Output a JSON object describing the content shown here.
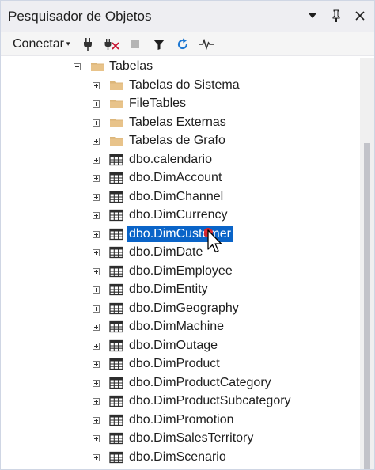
{
  "panel": {
    "title": "Pesquisador de Objetos",
    "controls": [
      "dropdown-icon",
      "pin-icon",
      "close-icon"
    ]
  },
  "toolbar": {
    "connect_label": "Conectar",
    "connect_arrow": "▾",
    "tools": [
      "connect-plug-icon",
      "disconnect-plug-icon",
      "stop-icon",
      "filter-icon",
      "refresh-icon",
      "activity-monitor-icon"
    ]
  },
  "tree": {
    "root": {
      "label": "Tabelas",
      "icon": "folder-icon",
      "expanded": true
    },
    "items": [
      {
        "label": "Tabelas do Sistema",
        "icon": "folder-icon",
        "selected": false
      },
      {
        "label": "FileTables",
        "icon": "folder-icon",
        "selected": false
      },
      {
        "label": "Tabelas Externas",
        "icon": "folder-icon",
        "selected": false
      },
      {
        "label": "Tabelas de Grafo",
        "icon": "folder-icon",
        "selected": false
      },
      {
        "label": "dbo.calendario",
        "icon": "table-icon",
        "selected": false
      },
      {
        "label": "dbo.DimAccount",
        "icon": "table-icon",
        "selected": false
      },
      {
        "label": "dbo.DimChannel",
        "icon": "table-icon",
        "selected": false
      },
      {
        "label": "dbo.DimCurrency",
        "icon": "table-icon",
        "selected": false
      },
      {
        "label": "dbo.DimCustomer",
        "icon": "table-icon",
        "selected": true
      },
      {
        "label": "dbo.DimDate",
        "icon": "table-icon",
        "selected": false
      },
      {
        "label": "dbo.DimEmployee",
        "icon": "table-icon",
        "selected": false
      },
      {
        "label": "dbo.DimEntity",
        "icon": "table-icon",
        "selected": false
      },
      {
        "label": "dbo.DimGeography",
        "icon": "table-icon",
        "selected": false
      },
      {
        "label": "dbo.DimMachine",
        "icon": "table-icon",
        "selected": false
      },
      {
        "label": "dbo.DimOutage",
        "icon": "table-icon",
        "selected": false
      },
      {
        "label": "dbo.DimProduct",
        "icon": "table-icon",
        "selected": false
      },
      {
        "label": "dbo.DimProductCategory",
        "icon": "table-icon",
        "selected": false
      },
      {
        "label": "dbo.DimProductSubcategory",
        "icon": "table-icon",
        "selected": false
      },
      {
        "label": "dbo.DimPromotion",
        "icon": "table-icon",
        "selected": false
      },
      {
        "label": "dbo.DimSalesTerritory",
        "icon": "table-icon",
        "selected": false
      },
      {
        "label": "dbo.DimScenario",
        "icon": "table-icon",
        "selected": false
      }
    ]
  },
  "colors": {
    "selection": "#0a64c8",
    "folder": "#dcb67a",
    "refresh": "#1e78d2",
    "cursor_highlight": "#e81e1e"
  }
}
